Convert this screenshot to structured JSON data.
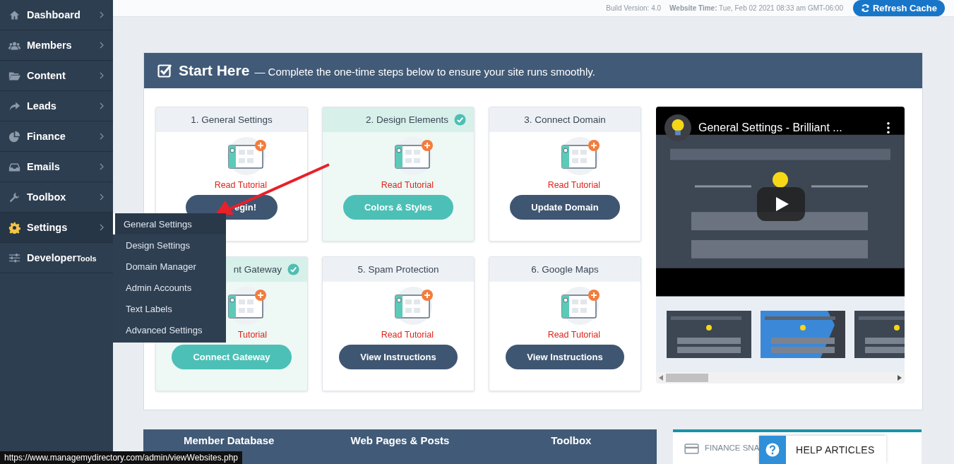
{
  "sidebar": {
    "items": [
      {
        "label": "Dashboard",
        "selected": false
      },
      {
        "label": "Members",
        "selected": false
      },
      {
        "label": "Content",
        "selected": false
      },
      {
        "label": "Leads",
        "selected": false
      },
      {
        "label": "Finance",
        "selected": false
      },
      {
        "label": "Emails",
        "selected": false
      },
      {
        "label": "Toolbox",
        "selected": false
      },
      {
        "label": "Settings",
        "selected": true
      },
      {
        "label": "Developer",
        "suffix": "Tools",
        "selected": false
      }
    ]
  },
  "submenu": {
    "items": [
      {
        "label": "General Settings",
        "selected": true
      },
      {
        "label": "Design Settings",
        "selected": false
      },
      {
        "label": "Domain Manager",
        "selected": false
      },
      {
        "label": "Admin Accounts",
        "selected": false
      },
      {
        "label": "Text Labels",
        "selected": false
      },
      {
        "label": "Advanced Settings",
        "selected": false
      }
    ]
  },
  "topbar": {
    "build": "Build Version: 4.0",
    "time": "**Website Time:** Tue, Feb 02 2021 08:33 am GMT-06:00",
    "refresh_button": "Refresh Cache"
  },
  "start_panel": {
    "title": "Start Here",
    "subtitle": "— Complete the one-time steps below to ensure your site runs smoothly.",
    "cards": [
      {
        "title": "1. General Settings",
        "done": false,
        "link": "Read Tutorial",
        "button": "egin!"
      },
      {
        "title": "2. Design Elements",
        "done": true,
        "link": "Read Tutorial",
        "button": "Colors & Styles"
      },
      {
        "title": "3. Connect Domain",
        "done": false,
        "link": "Read Tutorial",
        "button": "Update Domain"
      },
      {
        "title": "nt Gateway",
        "done": true,
        "link": "Tutorial",
        "button": "Connect Gateway"
      },
      {
        "title": "5. Spam Protection",
        "done": false,
        "link": "Read Tutorial",
        "button": "View Instructions"
      },
      {
        "title": "6. Google Maps",
        "done": false,
        "link": "Read Tutorial",
        "button": "View Instructions"
      }
    ],
    "video": {
      "title": "General Settings - Brilliant ..."
    }
  },
  "bottom_tabs": [
    "Member Database",
    "Web Pages & Posts",
    "Toolbox"
  ],
  "finance_card": {
    "title": "FINANCE SNA"
  },
  "help_button": "HELP ARTICLES",
  "status_url": "https://www.managemydirectory.com/admin/viewWebsites.php"
}
